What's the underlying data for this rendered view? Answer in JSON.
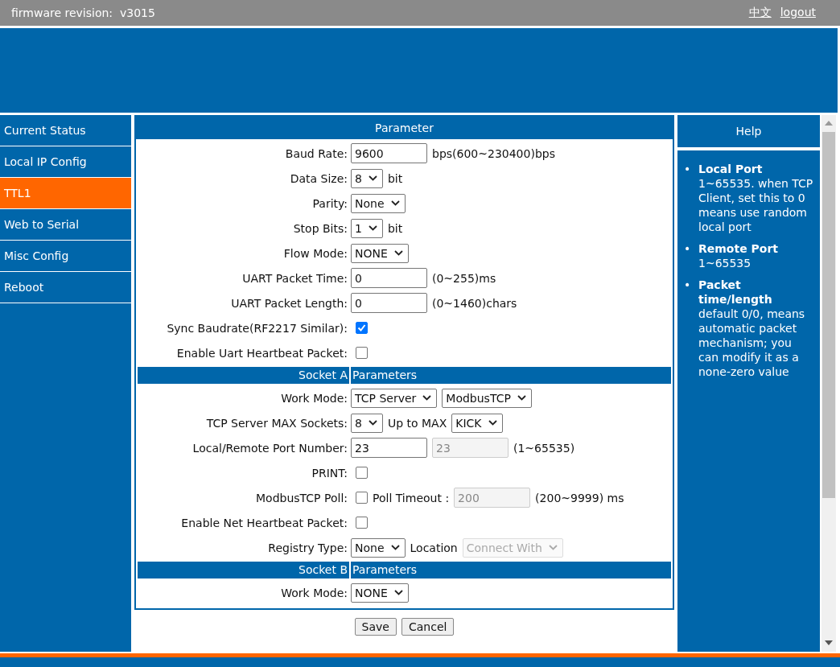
{
  "header": {
    "firmware": "firmware revision:  v3015",
    "links": [
      "中文",
      "logout"
    ]
  },
  "sidebar": [
    {
      "label": "Current Status",
      "selected": false
    },
    {
      "label": "Local IP Config",
      "selected": false
    },
    {
      "label": "TTL1",
      "selected": true
    },
    {
      "label": "Web to Serial",
      "selected": false
    },
    {
      "label": "Misc Config",
      "selected": false
    },
    {
      "label": "Reboot",
      "selected": false
    }
  ],
  "panel": {
    "title": "Parameter",
    "rows": [
      {
        "kind": "field",
        "label": "Baud Rate:",
        "items": [
          {
            "kind": "input",
            "value": "9600",
            "disabled": false
          },
          {
            "kind": "text",
            "text": "bps(600~230400)bps"
          }
        ]
      },
      {
        "kind": "field",
        "label": "Data Size:",
        "items": [
          {
            "kind": "select",
            "value": "8",
            "disabled": false
          },
          {
            "kind": "text",
            "text": "bit"
          }
        ]
      },
      {
        "kind": "field",
        "label": "Parity:",
        "items": [
          {
            "kind": "select",
            "value": "None",
            "disabled": false
          }
        ]
      },
      {
        "kind": "field",
        "label": "Stop Bits:",
        "items": [
          {
            "kind": "select",
            "value": "1",
            "disabled": false
          },
          {
            "kind": "text",
            "text": "bit"
          }
        ]
      },
      {
        "kind": "field",
        "label": "Flow Mode:",
        "items": [
          {
            "kind": "select",
            "value": "NONE",
            "disabled": false
          }
        ]
      },
      {
        "kind": "field",
        "label": "UART Packet Time:",
        "items": [
          {
            "kind": "input",
            "value": "0",
            "disabled": false
          },
          {
            "kind": "text",
            "text": "(0~255)ms"
          }
        ]
      },
      {
        "kind": "field",
        "label": "UART Packet Length:",
        "items": [
          {
            "kind": "input",
            "value": "0",
            "disabled": false
          },
          {
            "kind": "text",
            "text": "(0~1460)chars"
          }
        ]
      },
      {
        "kind": "field",
        "label": "Sync Baudrate(RF2217 Similar):",
        "items": [
          {
            "kind": "checkbox",
            "checked": true
          }
        ]
      },
      {
        "kind": "field",
        "label": "Enable Uart Heartbeat Packet:",
        "items": [
          {
            "kind": "checkbox",
            "checked": false
          }
        ]
      },
      {
        "kind": "section",
        "label": "Socket A",
        "title": "Parameters"
      },
      {
        "kind": "field",
        "label": "Work Mode:",
        "items": [
          {
            "kind": "select",
            "value": "TCP Server",
            "disabled": false
          },
          {
            "kind": "select",
            "value": "ModbusTCP",
            "disabled": false
          }
        ]
      },
      {
        "kind": "field",
        "label": "TCP Server MAX Sockets:",
        "items": [
          {
            "kind": "select",
            "value": "8",
            "disabled": false
          },
          {
            "kind": "text",
            "text": "Up to MAX"
          },
          {
            "kind": "select",
            "value": "KICK",
            "disabled": false
          }
        ]
      },
      {
        "kind": "field",
        "label": "Local/Remote Port Number:",
        "items": [
          {
            "kind": "input",
            "value": "23",
            "disabled": false
          },
          {
            "kind": "input",
            "value": "23",
            "disabled": true
          },
          {
            "kind": "text",
            "text": "(1~65535)"
          }
        ]
      },
      {
        "kind": "field",
        "label": "PRINT:",
        "items": [
          {
            "kind": "checkbox",
            "checked": false
          }
        ]
      },
      {
        "kind": "field",
        "label": "ModbusTCP Poll:",
        "items": [
          {
            "kind": "checkbox",
            "checked": false
          },
          {
            "kind": "text",
            "text": "Poll Timeout :"
          },
          {
            "kind": "input",
            "value": "200",
            "disabled": true
          },
          {
            "kind": "text",
            "text": "(200~9999) ms"
          }
        ]
      },
      {
        "kind": "field",
        "label": "Enable Net Heartbeat Packet:",
        "items": [
          {
            "kind": "checkbox",
            "checked": false
          }
        ]
      },
      {
        "kind": "field",
        "label": "Registry Type:",
        "items": [
          {
            "kind": "select",
            "value": "None",
            "disabled": false
          },
          {
            "kind": "text",
            "text": "Location"
          },
          {
            "kind": "select",
            "value": "Connect With",
            "disabled": true
          }
        ]
      },
      {
        "kind": "section",
        "label": "Socket B",
        "title": "Parameters"
      },
      {
        "kind": "field",
        "label": "Work Mode:",
        "items": [
          {
            "kind": "select",
            "value": "NONE",
            "disabled": false
          }
        ]
      }
    ]
  },
  "buttons": [
    "Save",
    "Cancel"
  ],
  "help": {
    "title": "Help",
    "items": [
      {
        "bullet": "•",
        "title": "Local Port",
        "text": "1~65535. when TCP Client, set this to 0 means use random local port"
      },
      {
        "bullet": "•",
        "title": "Remote Port",
        "text": "1~65535"
      },
      {
        "bullet": "•",
        "title": "Packet time/length",
        "text": "default 0/0, means automatic packet mechanism; you can modify it as a none-zero value"
      }
    ]
  }
}
